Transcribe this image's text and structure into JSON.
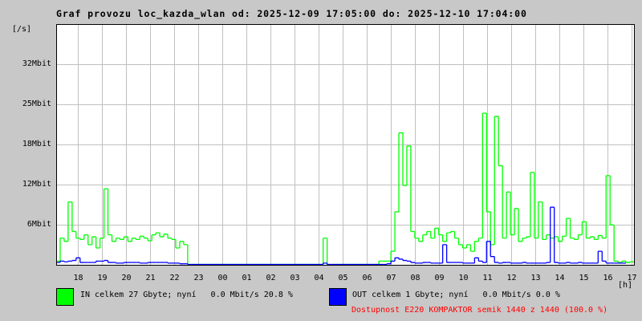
{
  "title": "Graf provozu loc_kazda_wlan od: 2025-12-09 17:05:00 do: 2025-12-10 17:04:00",
  "legend": {
    "in_text": "IN celkem 27 Gbyte; nyní   0.0 Mbit/s 20.8 %",
    "out_text": "OUT celkem 1 Gbyte; nyní   0.0 Mbit/s 0.0 %",
    "availability": "Dostupnost E220 KOMPAKTOR semik 1440 z 1440 (100.0 %)"
  },
  "colors": {
    "in": "#00ff00",
    "out": "#0000ff",
    "availability": "#ff0000",
    "grid": "#c0c0c0",
    "background": "#c8c8c8"
  },
  "chart_data": {
    "type": "line",
    "title": "Graf provozu loc_kazda_wlan od: 2025-12-09 17:05:00 do: 2025-12-10 17:04:00",
    "ylabel": "[/s]",
    "xlabel": "[h]",
    "ylim": [
      0,
      36.6
    ],
    "y_ticks": [
      "6Mbit",
      "12Mbit",
      "18Mbit",
      "25Mbit",
      "32Mbit"
    ],
    "x_ticks": [
      "18",
      "19",
      "20",
      "21",
      "22",
      "23",
      "00",
      "01",
      "02",
      "03",
      "04",
      "05",
      "06",
      "07",
      "08",
      "09",
      "10",
      "11",
      "12",
      "13",
      "14",
      "15",
      "16",
      "17"
    ],
    "x_start": "17:05",
    "x_step_minutes": 10,
    "grid": true,
    "legend_placement": "bottom",
    "series": [
      {
        "name": "IN",
        "values": [
          0.5,
          4,
          3.5,
          9.5,
          5,
          4,
          3.8,
          4.5,
          3,
          4.2,
          2.5,
          4,
          11.5,
          4.5,
          3.5,
          4,
          3.8,
          4.2,
          3.5,
          4,
          3.8,
          4.3,
          4,
          3.6,
          4.5,
          4.8,
          4.2,
          4.6,
          4,
          3.8,
          2.5,
          3.5,
          3,
          0,
          0,
          0,
          0,
          0,
          0,
          0,
          0,
          0,
          0,
          0,
          0,
          0,
          0,
          0,
          0,
          0,
          0,
          0,
          0,
          0,
          0,
          0,
          0,
          0,
          0,
          0,
          0,
          0,
          0,
          0,
          0,
          0,
          0,
          4,
          0,
          0,
          0,
          0,
          0,
          0,
          0,
          0,
          0,
          0,
          0,
          0,
          0,
          0.5,
          0.5,
          0.5,
          2,
          8,
          20,
          12,
          18,
          5,
          4,
          3.5,
          4.5,
          5,
          4,
          5.5,
          4.5,
          3.5,
          4.8,
          5,
          4,
          3,
          2.5,
          3,
          2,
          3.5,
          4,
          23,
          8,
          3,
          22.5,
          15,
          4,
          11,
          4.5,
          8.5,
          3.5,
          4,
          4.2,
          14,
          4,
          9.5,
          3.8,
          4.5,
          4,
          4.2,
          3.5,
          4.3,
          7,
          4,
          3.8,
          4.5,
          6.5,
          4,
          4.2,
          3.8,
          4.4,
          4,
          13.5,
          6,
          0.5,
          0.3,
          0.5,
          0.3,
          0.4
        ]
      },
      {
        "name": "OUT",
        "values": [
          0.3,
          0.5,
          0.4,
          0.5,
          0.6,
          1,
          0.3,
          0.3,
          0.3,
          0.3,
          0.5,
          0.5,
          0.6,
          0.3,
          0.3,
          0.2,
          0.2,
          0.3,
          0.3,
          0.3,
          0.3,
          0.2,
          0.2,
          0.3,
          0.3,
          0.3,
          0.3,
          0.3,
          0.2,
          0.2,
          0.2,
          0.1,
          0.1,
          0,
          0,
          0,
          0,
          0,
          0,
          0,
          0,
          0,
          0,
          0,
          0,
          0,
          0,
          0,
          0,
          0,
          0,
          0,
          0,
          0,
          0,
          0,
          0,
          0,
          0,
          0,
          0,
          0,
          0,
          0,
          0,
          0,
          0,
          0.2,
          0,
          0,
          0,
          0,
          0,
          0,
          0,
          0,
          0,
          0,
          0,
          0,
          0,
          0,
          0,
          0.1,
          0.5,
          1,
          0.8,
          0.6,
          0.5,
          0.3,
          0.2,
          0.2,
          0.3,
          0.3,
          0.2,
          0.2,
          0.2,
          3,
          0.3,
          0.3,
          0.3,
          0.3,
          0.2,
          0.2,
          0.2,
          1,
          0.5,
          0.3,
          3.5,
          1.2,
          0.3,
          0.2,
          0.3,
          0.3,
          0.2,
          0.2,
          0.2,
          0.3,
          0.2,
          0.2,
          0.2,
          0.2,
          0.2,
          0.3,
          8.7,
          0.3,
          0.2,
          0.2,
          0.3,
          0.2,
          0.2,
          0.3,
          0.2,
          0.2,
          0.2,
          0.2,
          2,
          0.5,
          0.2,
          0.2,
          0.2,
          0.2,
          0.2
        ]
      }
    ]
  }
}
